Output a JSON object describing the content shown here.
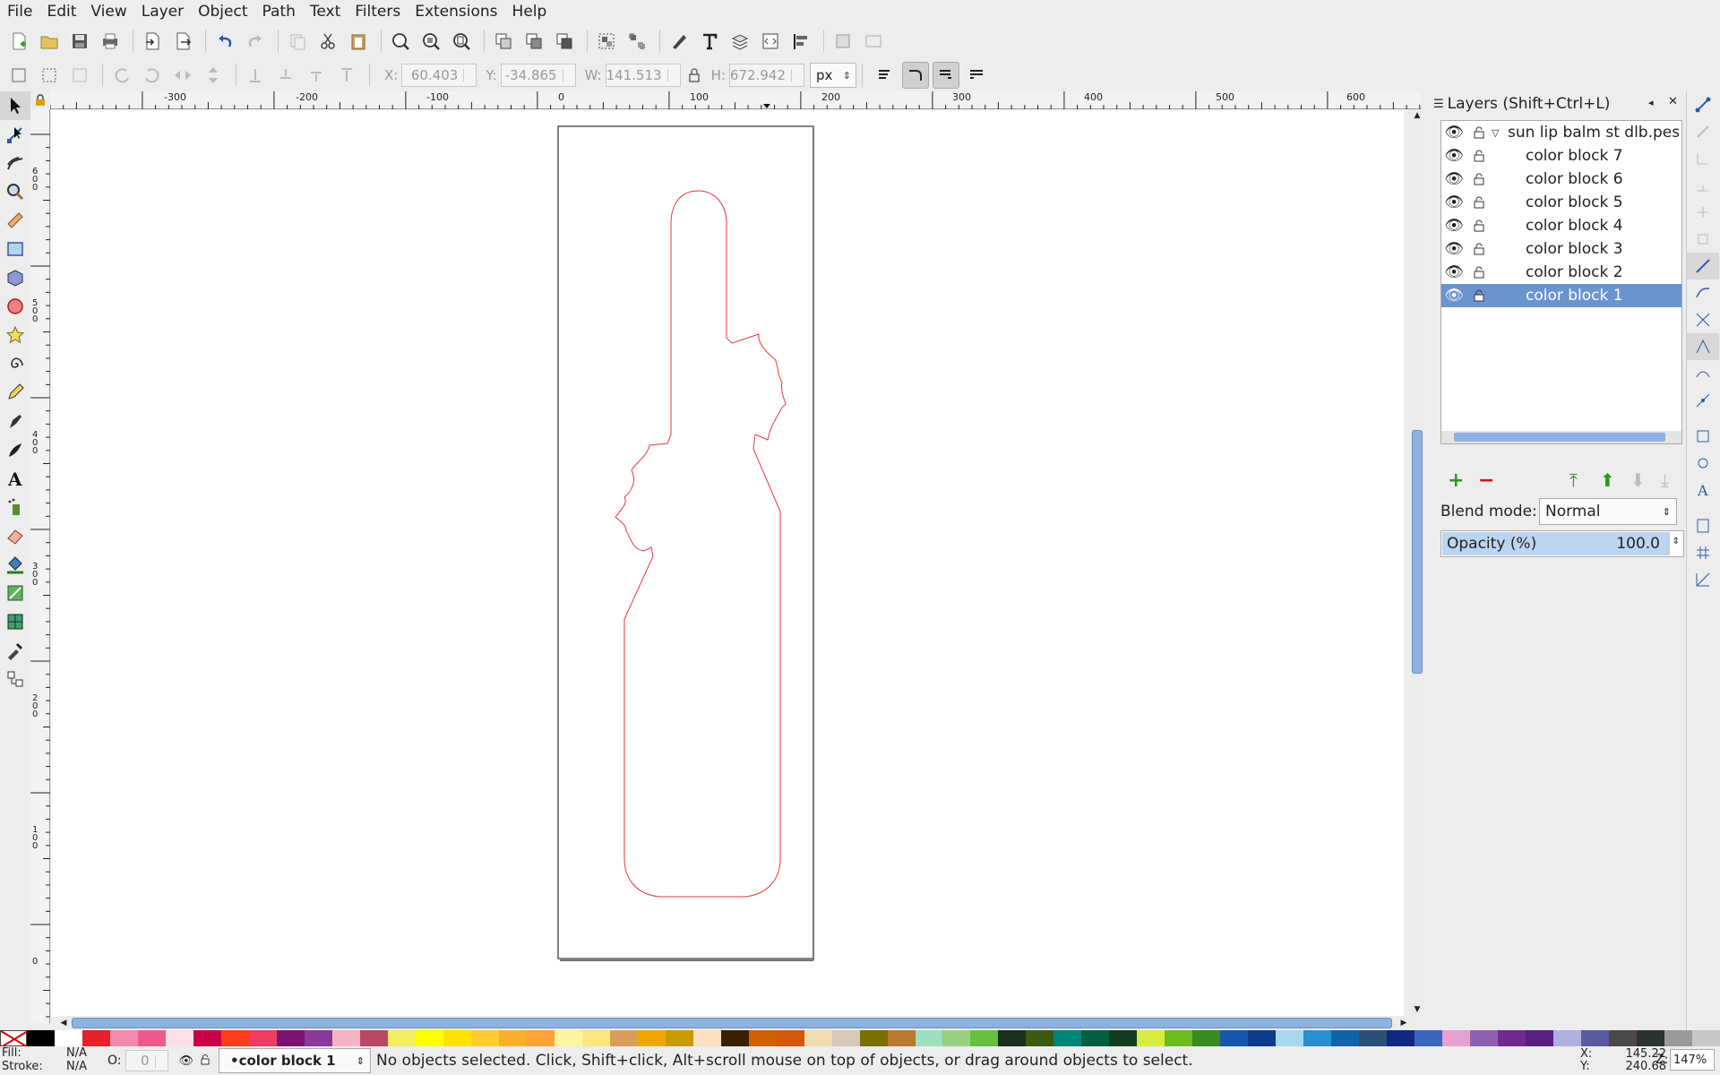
{
  "menu": [
    "File",
    "Edit",
    "View",
    "Layer",
    "Object",
    "Path",
    "Text",
    "Filters",
    "Extensions",
    "Help"
  ],
  "toolbar": {
    "x_label": "X:",
    "x_value": "60.403",
    "y_label": "Y:",
    "y_value": "-34.865",
    "w_label": "W:",
    "w_value": "141.513",
    "h_label": "H:",
    "h_value": "672.942",
    "unit": "px"
  },
  "ruler": {
    "top_labels": [
      "-300",
      "-200",
      "-100",
      "0",
      "100",
      "200",
      "300",
      "400",
      "500",
      "600"
    ],
    "left_labels": [
      "600",
      "500",
      "400",
      "300",
      "200",
      "100",
      "0"
    ]
  },
  "layers": {
    "title": "Layers (Shift+Ctrl+L)",
    "root": "sun lip balm st dlb.pes",
    "items": [
      "color block 7",
      "color block 6",
      "color block 5",
      "color block 4",
      "color block 3",
      "color block 2",
      "color block 1"
    ],
    "selected_index": 6,
    "blend_label": "Blend mode:",
    "blend_value": "Normal",
    "opacity_label": "Opacity (%)",
    "opacity_value": "100.0"
  },
  "status": {
    "fill_label": "Fill:",
    "fill_value": "N/A",
    "stroke_label": "Stroke:",
    "stroke_value": "N/A",
    "o_label": "O:",
    "o_value": "0",
    "layer_select": "•color block 1",
    "message": "No objects selected. Click, Shift+click, Alt+scroll mouse on top of objects, or drag around objects to select.",
    "x_label": "X:",
    "x_value": "145.22",
    "y_label": "Y:",
    "y_value": "240.68",
    "z_label": "Z:",
    "zoom": "147%"
  },
  "colors": {
    "accent": "#6b94cf",
    "outline": "#e8373f"
  },
  "palette": [
    "#000000",
    "#ffffff",
    "#e8202a",
    "#f28ab0",
    "#ef5a8c",
    "#fde0e6",
    "#c8004a",
    "#ff3c1a",
    "#f03c64",
    "#7b1270",
    "#8a3a9a",
    "#f5b4c4",
    "#b84a66",
    "#f2f060",
    "#ffff00",
    "#ffe100",
    "#ffcc33",
    "#f7b02a",
    "#fca335",
    "#fff4a0",
    "#ffe680",
    "#d6a05a",
    "#f0a800",
    "#c89a00",
    "#ffe0c0",
    "#3a2000",
    "#d06000",
    "#d4580a",
    "#f0dcb0",
    "#d8c8b8",
    "#7a7000",
    "#b87830",
    "#9de0c0",
    "#98d080",
    "#66c040",
    "#1a3020",
    "#3c5a10",
    "#00857a",
    "#006040",
    "#103c20",
    "#d8ec40",
    "#6cbc20",
    "#3a8a20",
    "#1458b0",
    "#0c3c8a",
    "#a8d8f0",
    "#2890d0",
    "#1064a8",
    "#2a5078",
    "#102880",
    "#3a66c0",
    "#e8a0d0",
    "#9060b0",
    "#702a90",
    "#5a2080",
    "#b0b0e0",
    "#5a5aa0",
    "#4a4a4a",
    "#2c3430",
    "#9a9a9a",
    "#c8c8c8"
  ]
}
